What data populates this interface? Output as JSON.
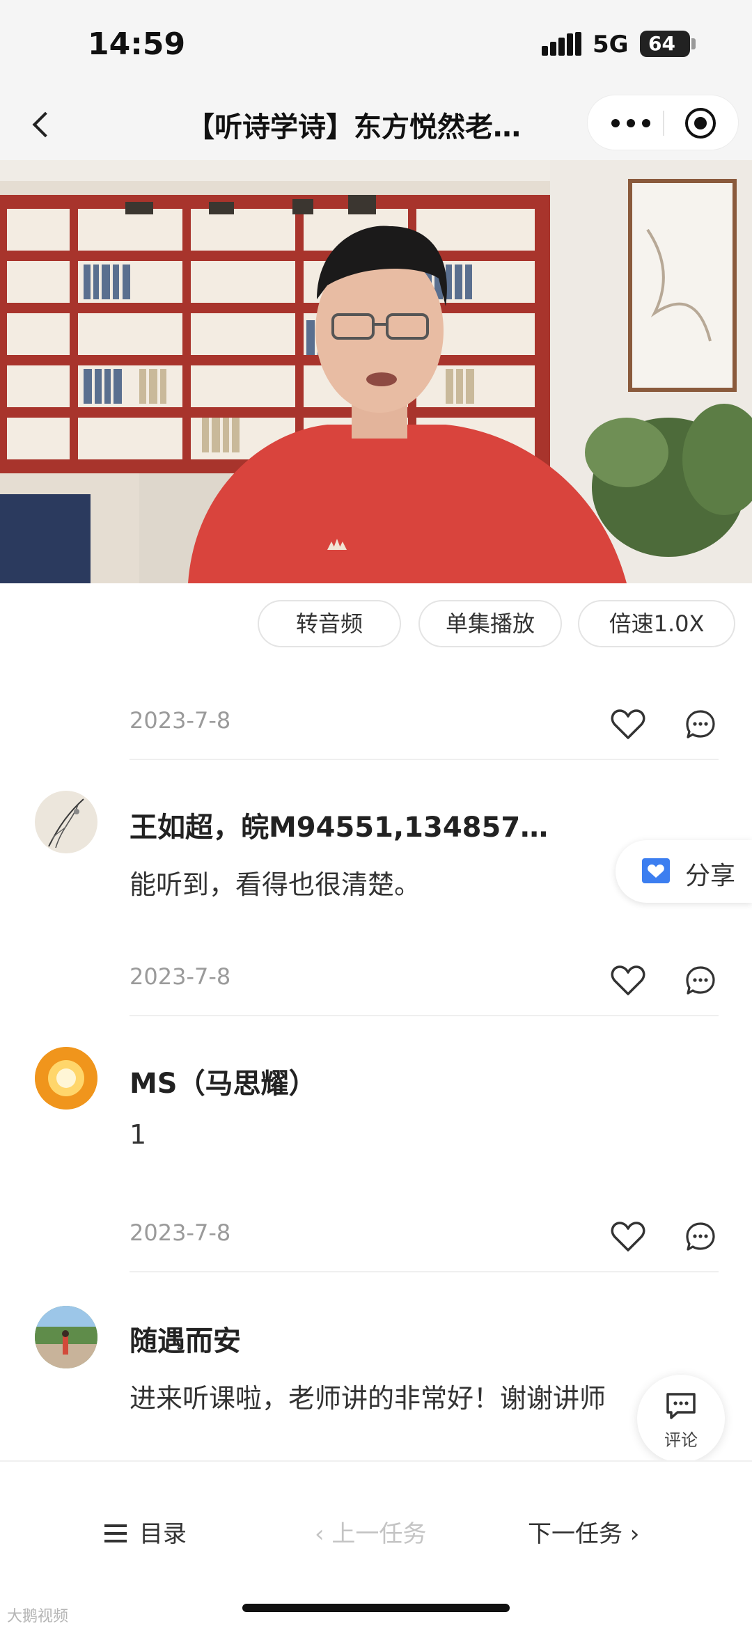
{
  "status_bar": {
    "time": "14:59",
    "network": "5G",
    "battery": "64"
  },
  "nav": {
    "title": "【听诗学诗】东方悦然老…"
  },
  "controls": [
    {
      "label": "转音频"
    },
    {
      "label": "单集播放"
    },
    {
      "label": "倍速1.0X"
    }
  ],
  "comments": [
    {
      "date": "2023-7-8",
      "username": "王如超，皖M94551,134857…",
      "text": "能听到，看得也很清楚。"
    },
    {
      "date": "2023-7-8",
      "username": "MS（马思耀）",
      "text": "1"
    },
    {
      "date": "2023-7-8",
      "username": "随遇而安",
      "text": "进来听课啦，老师讲的非常好！谢谢讲师"
    }
  ],
  "share": {
    "label": "分享"
  },
  "comment_fab": {
    "label": "评论"
  },
  "bottom_bar": {
    "toc_label": "目录",
    "prev_label": "上一任务",
    "next_label": "下一任务"
  },
  "watermark": "大鹅视频",
  "colors": {
    "accent_blue": "#3c7ef0",
    "sweater_red": "#d9443d",
    "bookshelf_red": "#a8342c"
  }
}
